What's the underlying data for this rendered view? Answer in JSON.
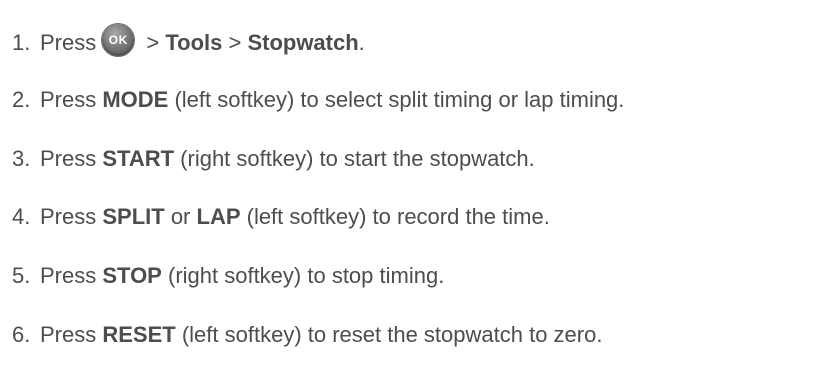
{
  "steps": [
    {
      "number": "1.",
      "parts": [
        "Press",
        "OK",
        " > ",
        "Tools",
        " > ",
        "Stopwatch",
        "."
      ]
    },
    {
      "number": "2.",
      "pre": "Press ",
      "key": "MODE",
      "post": " (left softkey) to select split timing or lap timing."
    },
    {
      "number": "3.",
      "pre": "Press ",
      "key": "START",
      "post": " (right softkey) to start the stopwatch."
    },
    {
      "number": "4.",
      "pre": "Press ",
      "key": "SPLIT",
      "mid": " or ",
      "key2": "LAP",
      "post": " (left softkey) to record the time."
    },
    {
      "number": "5.",
      "pre": "Press ",
      "key": "STOP",
      "post": " (right softkey) to stop timing."
    },
    {
      "number": "6.",
      "pre": "Press ",
      "key": "RESET",
      "post": " (left softkey) to reset the stopwatch to zero."
    }
  ]
}
